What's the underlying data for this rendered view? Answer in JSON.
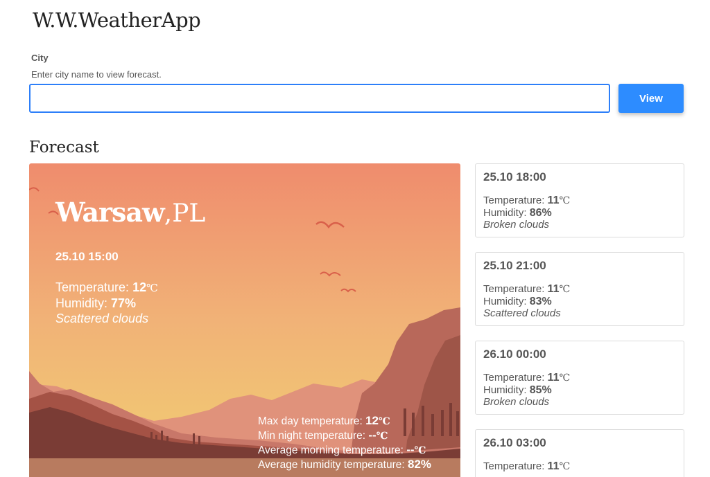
{
  "app": {
    "title": "W.W.WeatherApp"
  },
  "search": {
    "label": "City",
    "help": "Enter city name to view forecast.",
    "value": "",
    "button_label": "View"
  },
  "forecast": {
    "heading": "Forecast",
    "city": "Warsaw",
    "country": "PL",
    "current": {
      "datetime": "25.10 15:00",
      "temp_label": "Temperature:",
      "temp": "12",
      "humidity_label": "Humidity:",
      "humidity": "77%",
      "description": "Scattered clouds"
    },
    "summary": {
      "max_day_label": "Max day temperature:",
      "max_day": "12",
      "min_night_label": "Min night temperature:",
      "min_night": "--",
      "avg_morning_label": "Average morning temperature:",
      "avg_morning": "--",
      "avg_humidity_label": "Average humidity temperature:",
      "avg_humidity": "82%"
    },
    "unit": "℃",
    "items": [
      {
        "datetime": "25.10 18:00",
        "temp_label": "Temperature:",
        "temp": "11",
        "humidity_label": "Humidity:",
        "humidity": "86%",
        "description": "Broken clouds"
      },
      {
        "datetime": "25.10 21:00",
        "temp_label": "Temperature:",
        "temp": "11",
        "humidity_label": "Humidity:",
        "humidity": "83%",
        "description": "Scattered clouds"
      },
      {
        "datetime": "26.10 00:00",
        "temp_label": "Temperature:",
        "temp": "11",
        "humidity_label": "Humidity:",
        "humidity": "85%",
        "description": "Broken clouds"
      },
      {
        "datetime": "26.10 03:00",
        "temp_label": "Temperature:",
        "temp": "11",
        "humidity_label": "Humidity:",
        "humidity": "",
        "description": ""
      }
    ]
  },
  "colors": {
    "accent": "#2d8cff",
    "sky_top": "#ef8c6d",
    "sky_bottom": "#f1c374",
    "mountain_dark": "#7a3c35"
  }
}
